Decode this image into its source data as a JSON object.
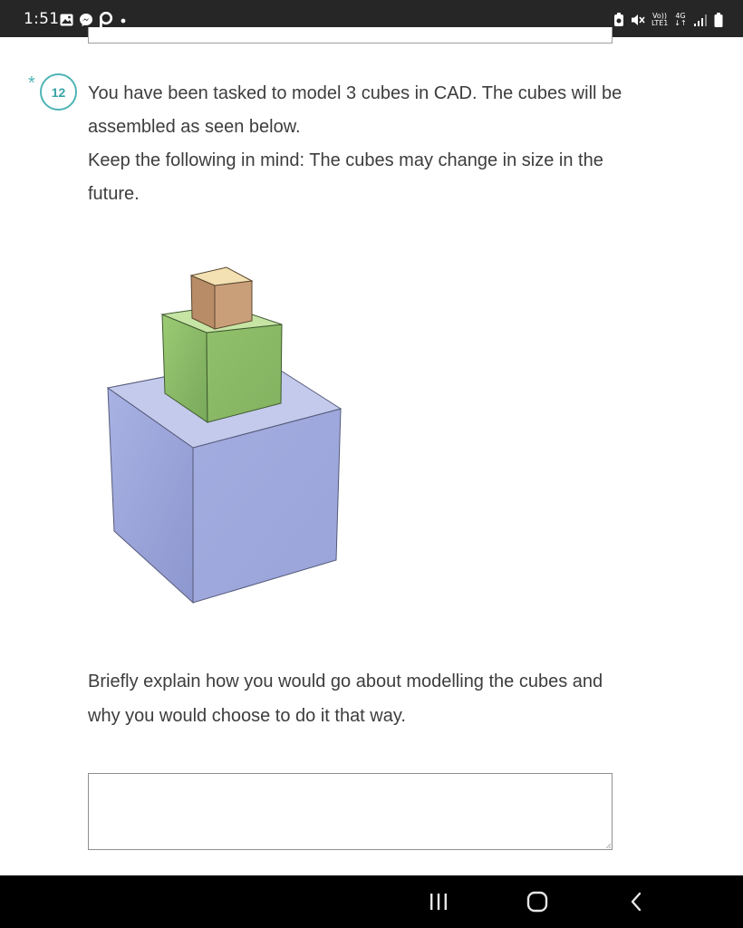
{
  "status_bar": {
    "time": "1:51",
    "left_icons": [
      "gallery-icon",
      "messenger-icon",
      "p-app-icon",
      "dot-icon"
    ],
    "volte_label": "Vo))",
    "lte_label": "LTE1",
    "network_label": "4G",
    "right_icons": [
      "alarm-icon",
      "mute-icon",
      "volte-icon",
      "network-4g-icon",
      "signal-icon",
      "battery-icon"
    ]
  },
  "question": {
    "number": "12",
    "required_mark": "*",
    "text_line1": "You have been tasked to model 3 cubes in CAD.  The cubes will be assembled as seen below.",
    "text_line2": "Keep the following in mind: The cubes may change in size in the future."
  },
  "figure": {
    "description_icon": "stacked-cubes-image",
    "colors": {
      "bottom_cube": "#9ea8dc",
      "middle_cube": "#8fbd6c",
      "top_cube": "#c79e77"
    }
  },
  "answer": {
    "prompt": "Briefly explain how you would go about modelling the cubes and why you would choose to do it that way.",
    "value": ""
  },
  "nav_bar": {
    "icons": [
      "recents-icon",
      "home-icon",
      "back-icon"
    ]
  }
}
